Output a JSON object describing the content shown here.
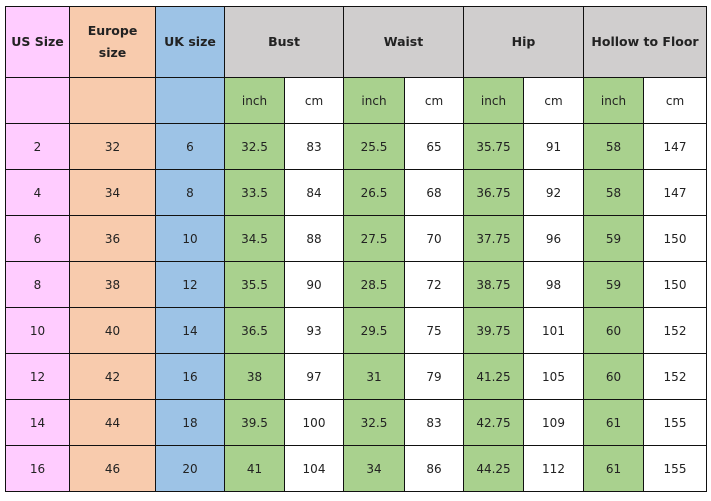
{
  "headers": {
    "us": "US Size",
    "eu": "Europe size",
    "uk": "UK size",
    "bust": "Bust",
    "waist": "Waist",
    "hip": "Hip",
    "hollow": "Hollow to Floor"
  },
  "units": {
    "inch": "inch",
    "cm": "cm"
  },
  "colors": {
    "us": "#ffccff",
    "eu": "#f8cbad",
    "uk": "#9dc3e6",
    "header": "#d0cece",
    "inch": "#a9d18e"
  },
  "rows": [
    [
      "2",
      "32",
      "6",
      "32.5",
      "83",
      "25.5",
      "65",
      "35.75",
      "91",
      "58",
      "147"
    ],
    [
      "4",
      "34",
      "8",
      "33.5",
      "84",
      "26.5",
      "68",
      "36.75",
      "92",
      "58",
      "147"
    ],
    [
      "6",
      "36",
      "10",
      "34.5",
      "88",
      "27.5",
      "70",
      "37.75",
      "96",
      "59",
      "150"
    ],
    [
      "8",
      "38",
      "12",
      "35.5",
      "90",
      "28.5",
      "72",
      "38.75",
      "98",
      "59",
      "150"
    ],
    [
      "10",
      "40",
      "14",
      "36.5",
      "93",
      "29.5",
      "75",
      "39.75",
      "101",
      "60",
      "152"
    ],
    [
      "12",
      "42",
      "16",
      "38",
      "97",
      "31",
      "79",
      "41.25",
      "105",
      "60",
      "152"
    ],
    [
      "14",
      "44",
      "18",
      "39.5",
      "100",
      "32.5",
      "83",
      "42.75",
      "109",
      "61",
      "155"
    ],
    [
      "16",
      "46",
      "20",
      "41",
      "104",
      "34",
      "86",
      "44.25",
      "112",
      "61",
      "155"
    ]
  ]
}
